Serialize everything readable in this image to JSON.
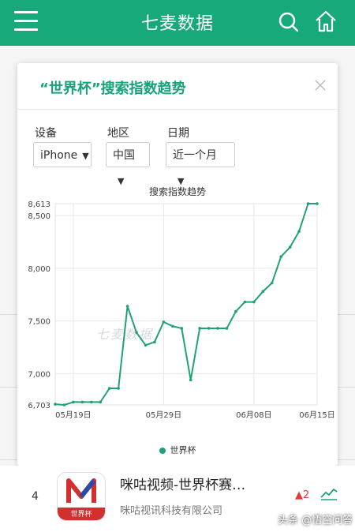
{
  "header": {
    "title": "七麦数据"
  },
  "dialog": {
    "title": "“世界杯”搜索指数趋势",
    "filters": [
      {
        "label": "设备",
        "value": "iPhone"
      },
      {
        "label": "地区",
        "value": "中国"
      },
      {
        "label": "日期",
        "value": "近一个月"
      }
    ]
  },
  "chart_data": {
    "type": "line",
    "title": "搜索指数趋势",
    "watermark": "七麦数据",
    "x_ticks": [
      "05月19日",
      "05月29日",
      "06月08日",
      "06月15日"
    ],
    "x": [
      "05-17",
      "05-18",
      "05-19",
      "05-20",
      "05-21",
      "05-22",
      "05-23",
      "05-24",
      "05-25",
      "05-26",
      "05-27",
      "05-28",
      "05-29",
      "05-30",
      "05-31",
      "06-01",
      "06-02",
      "06-03",
      "06-04",
      "06-05",
      "06-06",
      "06-07",
      "06-08",
      "06-09",
      "06-10",
      "06-11",
      "06-12",
      "06-13",
      "06-14",
      "06-15"
    ],
    "series": [
      {
        "name": "世界杯",
        "color": "#1fa27a",
        "values": [
          6710,
          6703,
          6730,
          6730,
          6730,
          6730,
          6860,
          6860,
          7640,
          7390,
          7270,
          7300,
          7490,
          7450,
          7430,
          6940,
          7430,
          7430,
          7430,
          7430,
          7590,
          7680,
          7680,
          7780,
          7860,
          8110,
          8200,
          8350,
          8613,
          8613
        ]
      }
    ],
    "y_ticks": [
      6703,
      7000,
      7500,
      8000,
      8500,
      8613
    ],
    "ylim": [
      6703,
      8613
    ],
    "grid": true,
    "legend": "bottom"
  },
  "list": {
    "rank": "4",
    "app_name": "咪咕视频-世界杯赛…",
    "developer": "咪咕视讯科技有限公司",
    "icon_text": "世界杯",
    "rank_change": "▲2"
  },
  "brand": "头条 @悟空问答"
}
